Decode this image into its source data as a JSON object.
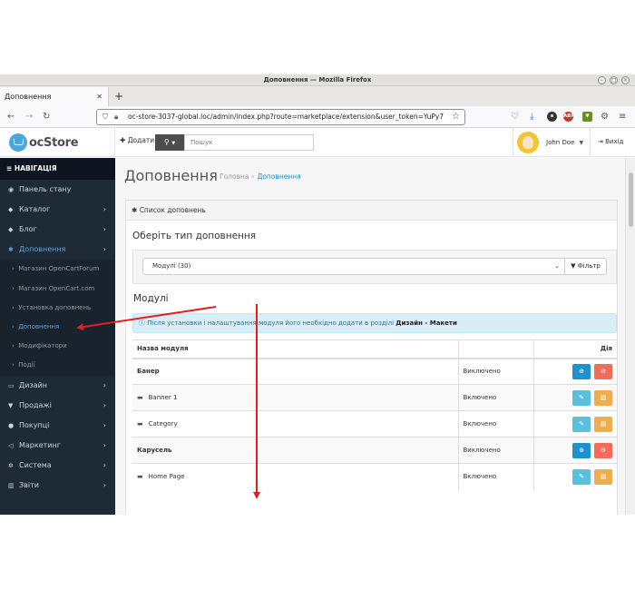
{
  "window": {
    "title": "Доповнення — Mozilla Firefox"
  },
  "browser": {
    "tab_title": "Доповнення",
    "url": "oc-store-3037-global.loc/admin/index.php?route=marketplace/extension&user_token=YuPy7"
  },
  "header": {
    "logo_text": "ocStore",
    "add_label": "Додати",
    "search_placeholder": "Пошук",
    "user_name": "John Doe",
    "logout_label": "Вихід"
  },
  "sidebar": {
    "nav_title": "НАВІГАЦІЯ",
    "items": [
      {
        "icon": "dashboard-icon",
        "label": "Панель стану",
        "chevron": false
      },
      {
        "icon": "tag-icon",
        "label": "Каталог",
        "chevron": true
      },
      {
        "icon": "tag-icon",
        "label": "Блог",
        "chevron": true
      },
      {
        "icon": "puzzle-icon",
        "label": "Доповнення",
        "chevron": true,
        "active": true
      }
    ],
    "subitems": [
      "Магазин OpenCartForum",
      "Магазин OpenCart.com",
      "Установка доповнень",
      "Доповнення",
      "Модифікатори",
      "Події"
    ],
    "items_after": [
      {
        "icon": "desktop-icon",
        "label": "Дизайн"
      },
      {
        "icon": "cart-icon",
        "label": "Продажі"
      },
      {
        "icon": "user-icon",
        "label": "Покупці"
      },
      {
        "icon": "share-icon",
        "label": "Маркетинг"
      },
      {
        "icon": "gear-icon",
        "label": "Система"
      },
      {
        "icon": "bar-chart-icon",
        "label": "Звіти"
      }
    ]
  },
  "main": {
    "page_title": "Доповнення",
    "breadcrumb": [
      "Головна",
      "Доповнення"
    ],
    "panel_title": "Список доповнень",
    "choose_type_heading": "Оберіть тип доповнення",
    "type_select_value": "Модулі (30)",
    "filter_label": "Фільтр",
    "modules_heading": "Модулі",
    "alert_text": "Після установки і налаштування модуля його необхідно додати в розділі ",
    "alert_bold": "Дизайн - Макети",
    "table": {
      "headers": [
        "Назва модуля",
        "",
        "Дія"
      ],
      "rows": [
        {
          "name": "Банер",
          "status": "Виключено",
          "child": false
        },
        {
          "name": "Banner 1",
          "status": "Включено",
          "child": true
        },
        {
          "name": "Category",
          "status": "Включено",
          "child": true
        },
        {
          "name": "Карусель",
          "status": "Виключено",
          "child": false
        },
        {
          "name": "Home Page",
          "status": "Включено",
          "child": true
        }
      ]
    }
  },
  "colors": {
    "sidebar_bg": "#1e2a36",
    "accent_blue": "#1e91cf",
    "annotation_red": "#e02020"
  }
}
